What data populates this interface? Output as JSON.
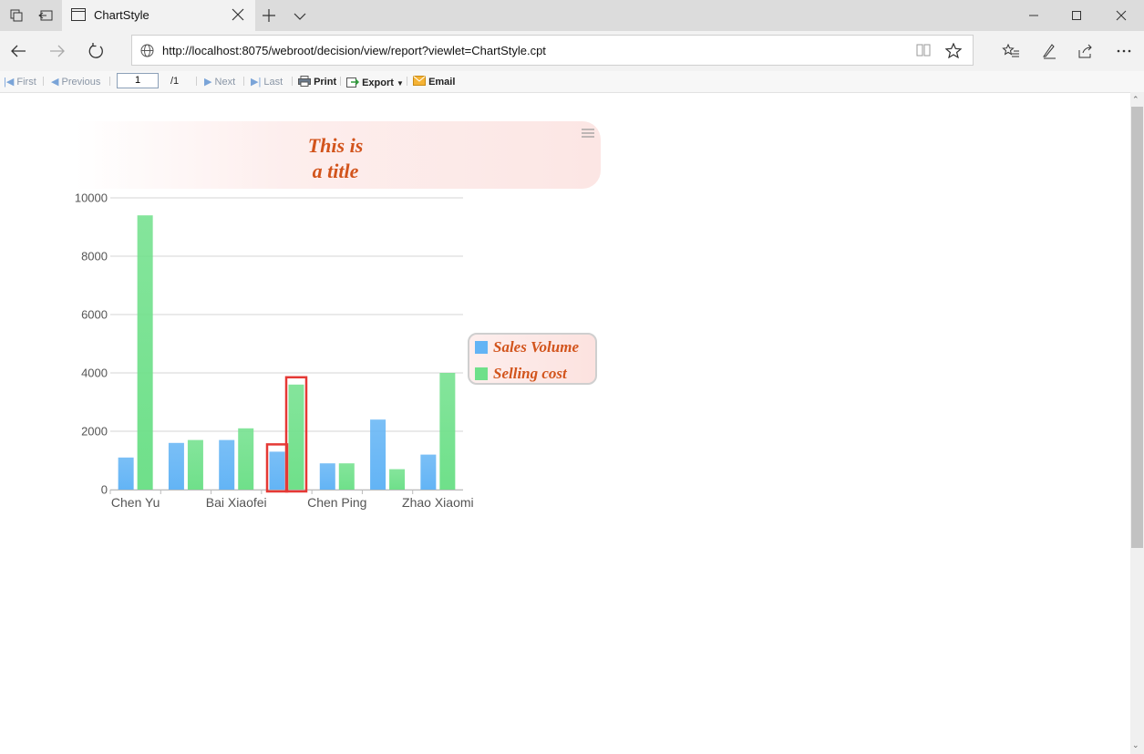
{
  "browser": {
    "tab_title": "ChartStyle",
    "url": "http://localhost:8075/webroot/decision/view/report?viewlet=ChartStyle.cpt"
  },
  "report_toolbar": {
    "first": "First",
    "previous": "Previous",
    "page_value": "1",
    "page_total": "/1",
    "next": "Next",
    "last": "Last",
    "print": "Print",
    "export": "Export",
    "email": "Email"
  },
  "chart": {
    "title_line1": "This is",
    "title_line2": "a title"
  },
  "colors": {
    "sales_volume": "#63b4f5",
    "selling_cost": "#6fe08a",
    "title": "#d2541c",
    "highlight": "#e53935"
  },
  "chart_data": {
    "type": "bar",
    "categories": [
      "Chen Yu",
      "",
      "Bai Xiaofei",
      "",
      "Chen Ping",
      "",
      "Zhao Xiaomi"
    ],
    "series": [
      {
        "name": "Sales Volume",
        "values": [
          1100,
          1600,
          1700,
          1300,
          900,
          2400,
          1200
        ]
      },
      {
        "name": "Selling cost",
        "values": [
          9400,
          1700,
          2100,
          3600,
          900,
          700,
          4000
        ]
      }
    ],
    "ylim": [
      0,
      10000
    ],
    "yticks": [
      "10000",
      "8000",
      "6000",
      "4000",
      "2000",
      "0"
    ],
    "grid": true,
    "legend_position": "right"
  }
}
